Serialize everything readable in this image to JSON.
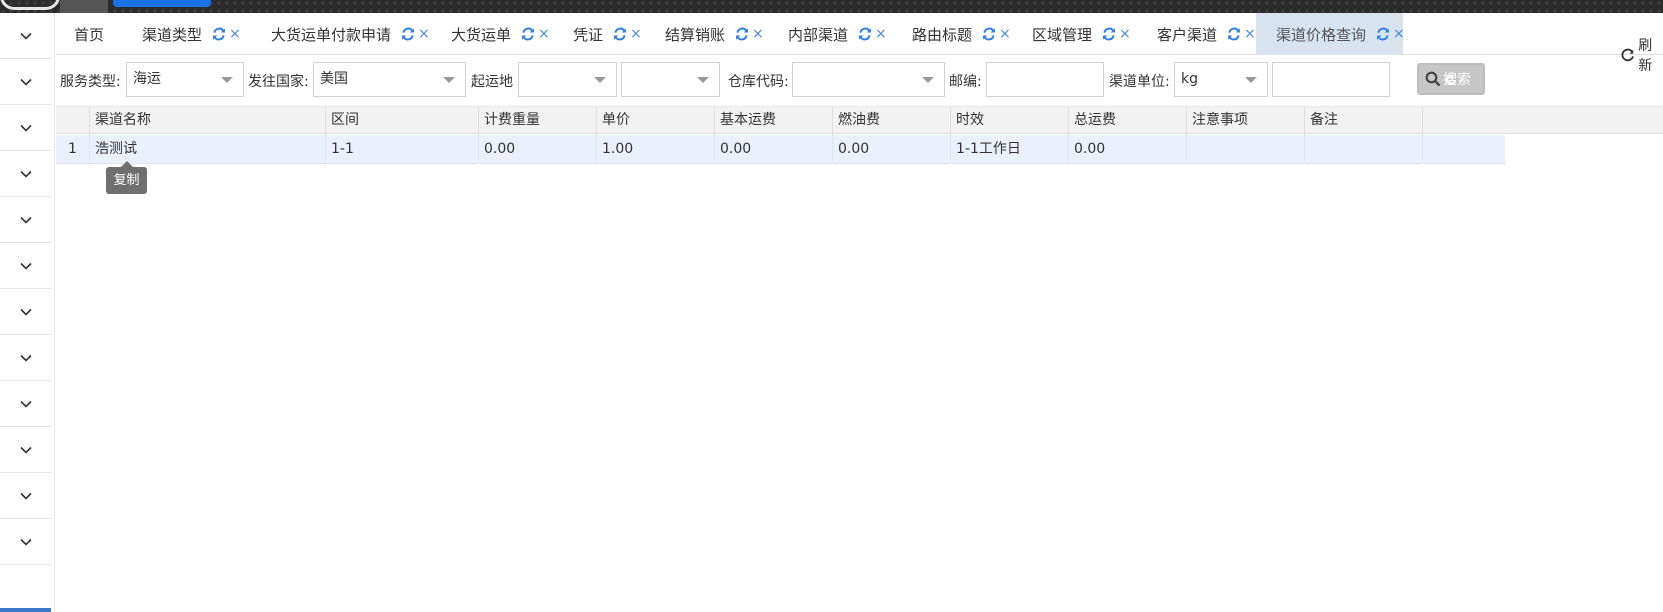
{
  "tabs": [
    {
      "label": "首页",
      "closable": false
    },
    {
      "label": "渠道类型",
      "closable": true
    },
    {
      "label": "大货运单付款申请",
      "closable": true
    },
    {
      "label": "大货运单",
      "closable": true
    },
    {
      "label": "凭证",
      "closable": true
    },
    {
      "label": "结算销账",
      "closable": true
    },
    {
      "label": "内部渠道",
      "closable": true
    },
    {
      "label": "路由标题",
      "closable": true
    },
    {
      "label": "区域管理",
      "closable": true
    },
    {
      "label": "客户渠道",
      "closable": true
    },
    {
      "label": "渠道价格查询",
      "closable": true,
      "active": true
    }
  ],
  "refresh_label": "刷新",
  "filters": {
    "service_type_label": "服务类型:",
    "service_type_value": "海运",
    "country_label": "发往国家:",
    "country_value": "美国",
    "origin_label": "起运地",
    "origin_value": "",
    "origin2_value": "",
    "warehouse_label": "仓库代码:",
    "warehouse_value": "",
    "zip_label": "邮编:",
    "zip_value": "",
    "unit_label": "渠道单位:",
    "unit_value": "kg",
    "extra_value": "",
    "search_label": "搜索"
  },
  "grid": {
    "columns": [
      "渠道名称",
      "区间",
      "计费重量",
      "单价",
      "基本运费",
      "燃油费",
      "时效",
      "总运费",
      "注意事项",
      "备注"
    ],
    "rows": [
      {
        "num": "1",
        "cells": [
          "浩测试",
          "1-1",
          "0.00",
          "1.00",
          "0.00",
          "0.00",
          "1-1工作日",
          "0.00",
          "",
          ""
        ]
      }
    ]
  },
  "tooltip": "复制",
  "colors": {
    "accent": "#4a8ad8",
    "active_tab_bg": "#d8e3f0",
    "row_selected_bg": "#eaf1fd"
  },
  "icons": {
    "tab_refresh": "refresh-icon",
    "tab_close": "close-icon",
    "sidebar": "chevron-down-icon",
    "search": "search-icon"
  }
}
